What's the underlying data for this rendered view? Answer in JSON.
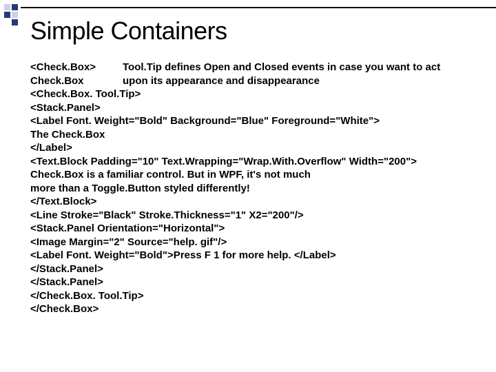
{
  "title": "Simple Containers",
  "callout": {
    "line1": "Tool.Tip defines Open and Closed events in case you want to act",
    "line2": "upon its appearance and disappearance"
  },
  "code": {
    "l1": "<Check.Box>",
    "l2": "Check.Box",
    "l3": "<Check.Box. Tool.Tip>",
    "l4": "<Stack.Panel>",
    "l5": "<Label Font. Weight=\"Bold\" Background=\"Blue\" Foreground=\"White\">",
    "l6": "The Check.Box",
    "l7": "</Label>",
    "l8": "<Text.Block Padding=\"10\" Text.Wrapping=\"Wrap.With.Overflow\" Width=\"200\">",
    "l9": "Check.Box is a familiar control. But in WPF, it's not much",
    "l10": "more than a Toggle.Button styled differently!",
    "l11": "</Text.Block>",
    "l12": "<Line Stroke=\"Black\" Stroke.Thickness=\"1\" X2=\"200\"/>",
    "l13": "<Stack.Panel Orientation=\"Horizontal\">",
    "l14": "<Image Margin=\"2\" Source=\"help. gif\"/>",
    "l15": "<Label Font. Weight=\"Bold\">Press F 1 for more help. </Label>",
    "l16": "</Stack.Panel>",
    "l17": "</Stack.Panel>",
    "l18": "</Check.Box. Tool.Tip>",
    "l19": "</Check.Box>"
  }
}
